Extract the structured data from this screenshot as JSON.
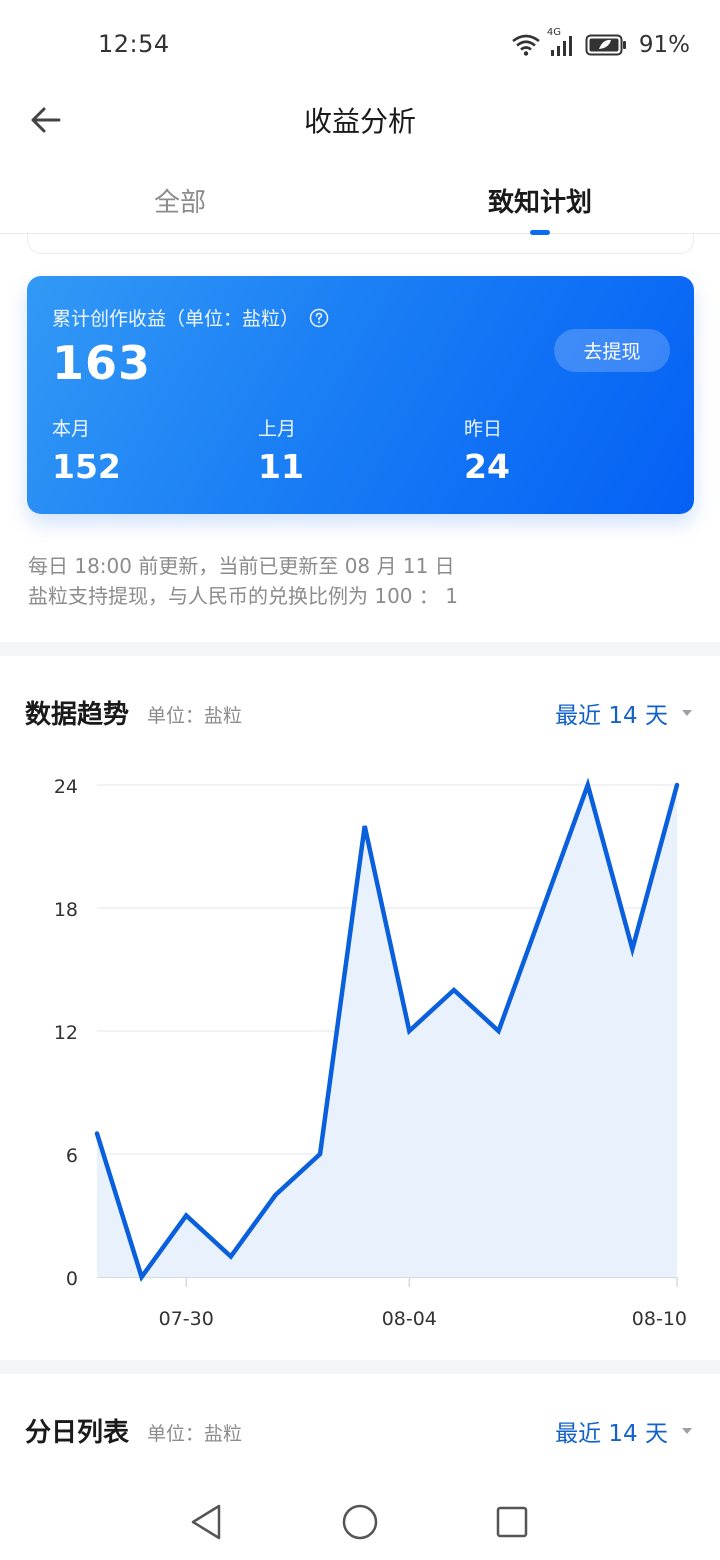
{
  "status": {
    "time": "12:54",
    "network": "4G",
    "battery": "91%"
  },
  "header": {
    "title": "收益分析"
  },
  "tabs": [
    {
      "label": "全部",
      "active": false
    },
    {
      "label": "致知计划",
      "active": true
    }
  ],
  "earnings": {
    "label": "累计创作收益（单位：盐粒）",
    "total": "163",
    "withdraw_label": "去提现",
    "stats": [
      {
        "label": "本月",
        "value": "152"
      },
      {
        "label": "上月",
        "value": "11"
      },
      {
        "label": "昨日",
        "value": "24"
      }
    ]
  },
  "notes": [
    "每日 18:00 前更新，当前已更新至 08 月 11 日",
    "盐粒支持提现，与人民币的兑换比例为 100 ： 1"
  ],
  "trend": {
    "title": "数据趋势",
    "unit": "单位：盐粒",
    "range_label": "最近 14 天"
  },
  "daily": {
    "title": "分日列表",
    "unit": "单位：盐粒",
    "range_label": "最近 14 天"
  },
  "colors": {
    "accent": "#0a6cf0",
    "line": "#0a5fdc",
    "area": "#e8f1fc"
  },
  "chart_data": {
    "type": "area",
    "x": [
      "07-28",
      "07-29",
      "07-30",
      "07-31",
      "08-01",
      "08-02",
      "08-03",
      "08-04",
      "08-05",
      "08-06",
      "08-07",
      "08-08",
      "08-09",
      "08-10"
    ],
    "x_tick_labels": [
      "07-30",
      "08-04",
      "08-10"
    ],
    "series": [
      {
        "values": [
          7,
          0,
          3,
          1,
          4,
          6,
          22,
          12,
          14,
          12,
          18,
          24,
          16,
          24
        ]
      }
    ],
    "y_ticks": [
      0,
      6,
      12,
      18,
      24
    ],
    "ylim": [
      0,
      24
    ],
    "grid": true,
    "title": "",
    "xlabel": "",
    "ylabel": ""
  }
}
